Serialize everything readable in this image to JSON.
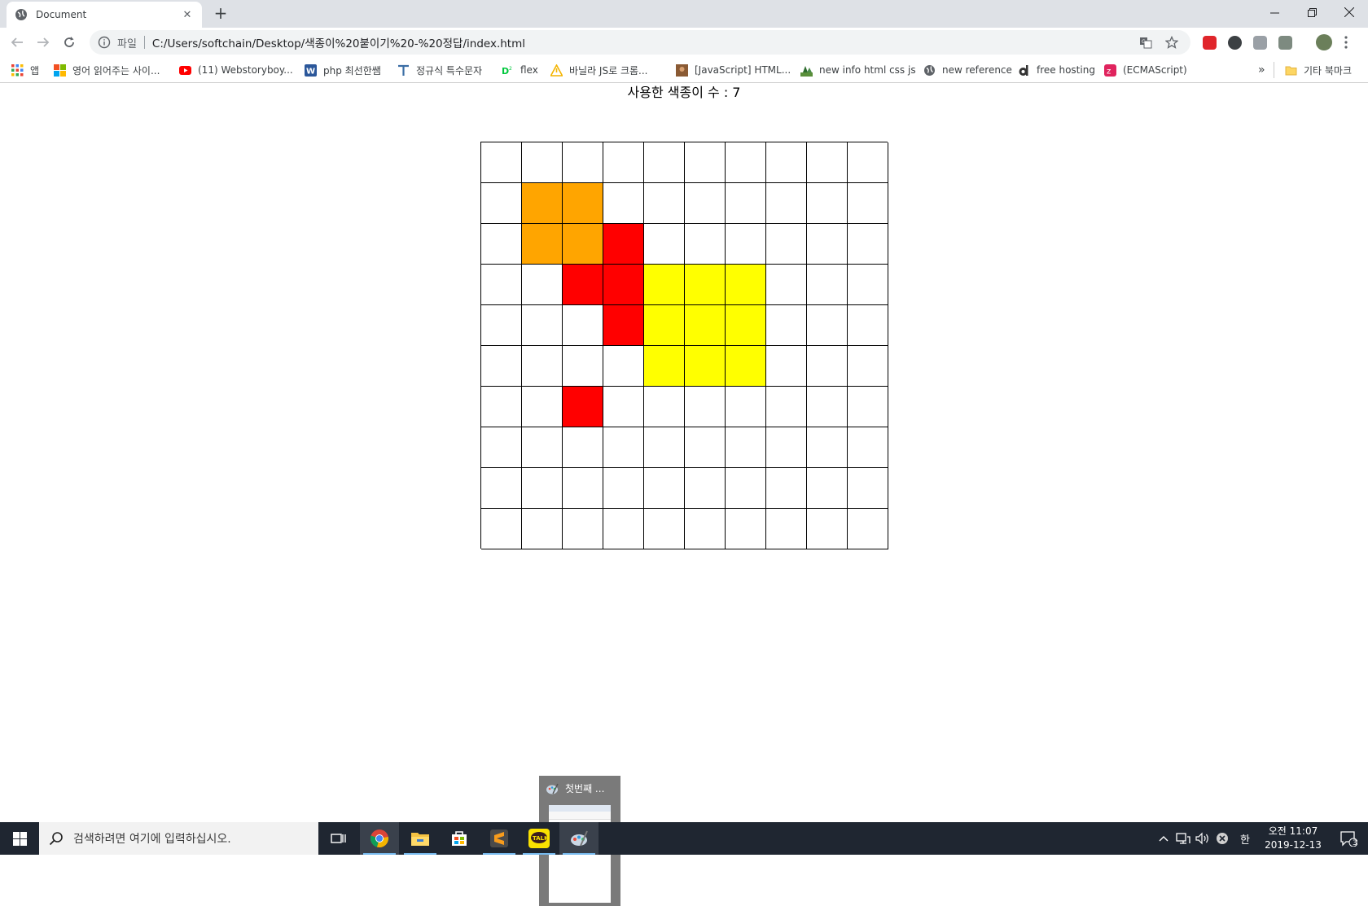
{
  "browser": {
    "tab_title": "Document",
    "new_tab_label": "+",
    "scheme_label": "파일",
    "url": "C:/Users/softchain/Desktop/색종이%20붙이기%20-%20정답/index.html",
    "bookmarks": [
      {
        "label": "앱",
        "icon": "apps-grid-icon"
      },
      {
        "label": "영어 읽어주는 사이...",
        "icon": "color-squares-icon"
      },
      {
        "label": "(11) Webstoryboy...",
        "icon": "youtube-icon"
      },
      {
        "label": "php 최선한쌤",
        "icon": "word-icon"
      },
      {
        "label": "정규식 특수문자",
        "icon": "typora-icon"
      },
      {
        "label": "flex",
        "icon": "d2-icon"
      },
      {
        "label": "바닐라 JS로 크롬...",
        "icon": "warning-triangle-icon"
      },
      {
        "label": "[JavaScript] HTML...",
        "icon": "photo-icon"
      },
      {
        "label": "new info html css js",
        "icon": "tree-icon"
      },
      {
        "label": "new reference",
        "icon": "globe-icon"
      },
      {
        "label": "free hosting",
        "icon": "dothome-icon"
      },
      {
        "label": "(ECMAScript)",
        "icon": "zero-icon"
      }
    ],
    "more_bookmarks_label": "»",
    "other_bookmarks_label": "기타 북마크"
  },
  "page": {
    "counter_text": "사용한 색종이 수 : 7",
    "grid": {
      "rows": 10,
      "cols": 10,
      "colors": {
        "O": "#ffa500",
        "R": "#ff0000",
        "Y": "#ffff00",
        ".": "#ffffff"
      },
      "cells": [
        "..........",
        ".OO.......",
        ".OOR......",
        "..RRYYY...",
        "...RYYY...",
        "....YYY...",
        "..R.......",
        "..........",
        "..........",
        ".........."
      ]
    }
  },
  "thumbnail": {
    "label": "첫번째 ..."
  },
  "taskbar": {
    "search_placeholder": "검색하려면 여기에 입력하십시오.",
    "clock_time": "오전 11:07",
    "clock_date": "2019-12-13",
    "ime_label": "한",
    "notification_count": "3"
  }
}
